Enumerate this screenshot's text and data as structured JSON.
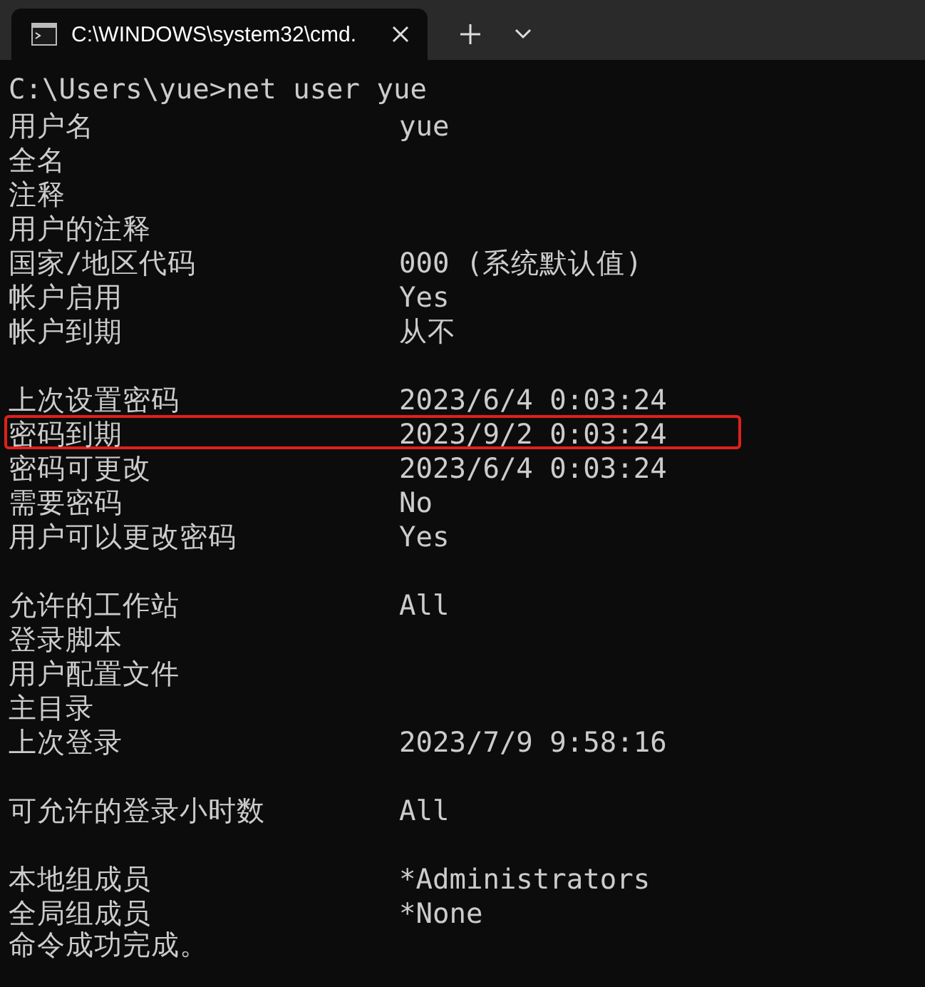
{
  "window": {
    "tab_title": "C:\\WINDOWS\\system32\\cmd."
  },
  "lines": [
    {
      "kind": "command",
      "text": "C:\\Users\\yue>net user yue"
    },
    {
      "kind": "field",
      "label": "用户名",
      "value": "yue",
      "highlighted": false
    },
    {
      "kind": "field",
      "label": "全名",
      "highlighted": false
    },
    {
      "kind": "field",
      "label": "注释",
      "highlighted": false
    },
    {
      "kind": "field",
      "label": "用户的注释",
      "highlighted": false
    },
    {
      "kind": "field",
      "label": "国家/地区代码",
      "value": "000 (系统默认值)",
      "highlighted": false
    },
    {
      "kind": "field",
      "label": "帐户启用",
      "value": "Yes",
      "highlighted": false
    },
    {
      "kind": "field",
      "label": "帐户到期",
      "value": "从不",
      "highlighted": false
    },
    {
      "kind": "blank"
    },
    {
      "kind": "field",
      "label": "上次设置密码",
      "value": "2023/6/4 0:03:24",
      "highlighted": false
    },
    {
      "kind": "field",
      "label": "密码到期",
      "value": "2023/9/2 0:03:24",
      "highlighted": true
    },
    {
      "kind": "field",
      "label": "密码可更改",
      "value": "2023/6/4 0:03:24",
      "highlighted": false
    },
    {
      "kind": "field",
      "label": "需要密码",
      "value": "No",
      "highlighted": false
    },
    {
      "kind": "field",
      "label": "用户可以更改密码",
      "value": "Yes",
      "highlighted": false
    },
    {
      "kind": "blank"
    },
    {
      "kind": "field",
      "label": "允许的工作站",
      "value": "All",
      "highlighted": false
    },
    {
      "kind": "field",
      "label": "登录脚本",
      "highlighted": false
    },
    {
      "kind": "field",
      "label": "用户配置文件",
      "highlighted": false
    },
    {
      "kind": "field",
      "label": "主目录",
      "highlighted": false
    },
    {
      "kind": "field",
      "label": "上次登录",
      "value": "2023/7/9 9:58:16",
      "highlighted": false
    },
    {
      "kind": "blank"
    },
    {
      "kind": "field",
      "label": "可允许的登录小时数",
      "value": "All",
      "highlighted": false
    },
    {
      "kind": "blank"
    },
    {
      "kind": "field",
      "label": "本地组成员",
      "value": "*Administrators",
      "highlighted": false
    },
    {
      "kind": "field",
      "label": "全局组成员",
      "value": "*None",
      "highlighted": false
    },
    {
      "kind": "command",
      "text": "命令成功完成。"
    }
  ]
}
